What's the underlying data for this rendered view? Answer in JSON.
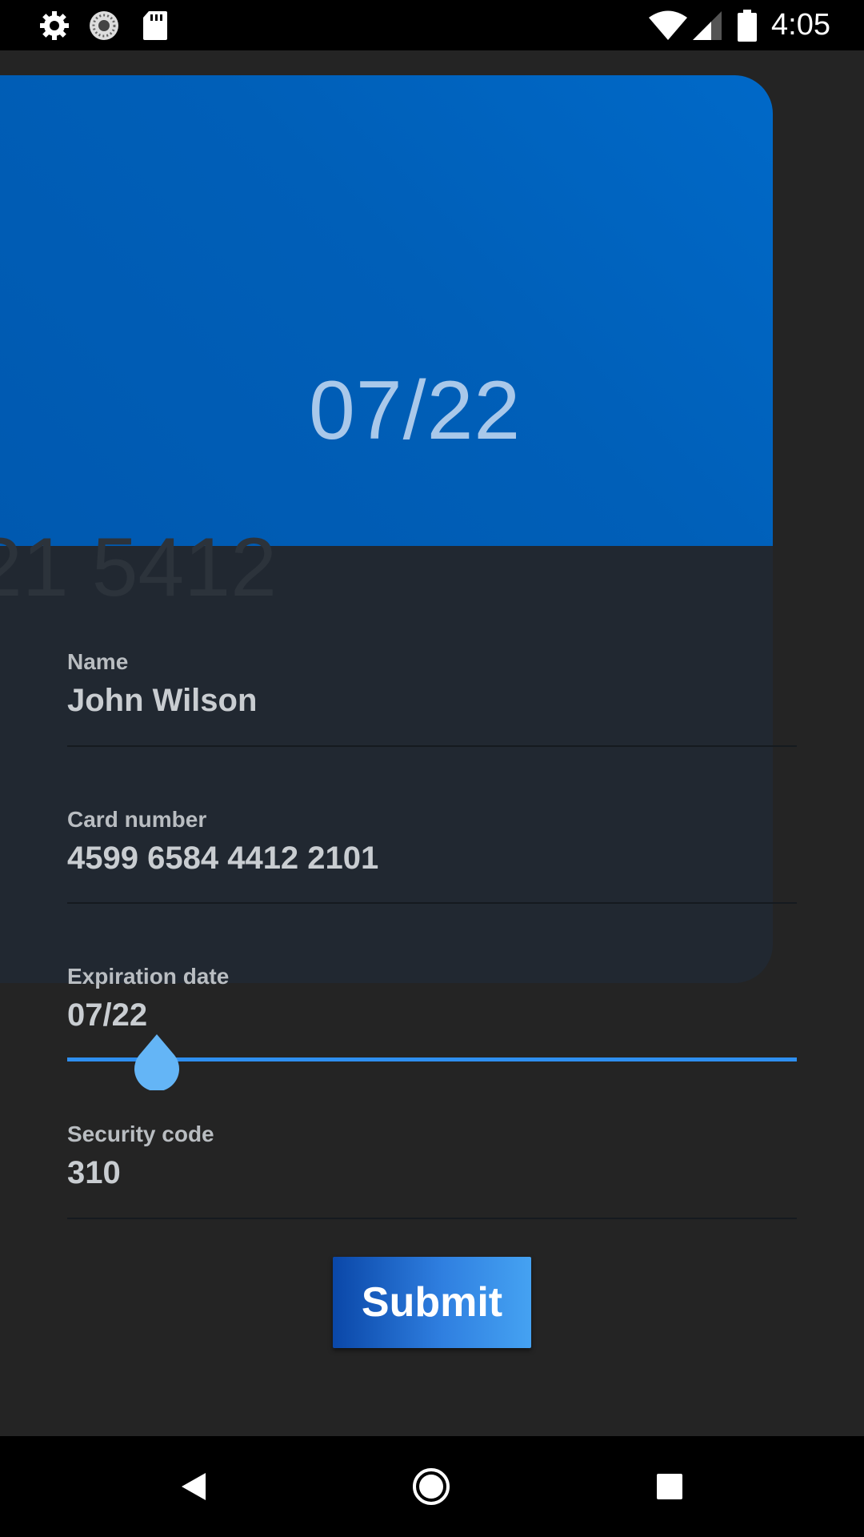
{
  "status_bar": {
    "time": "4:05",
    "icons": [
      "gear-icon",
      "sync-icon",
      "sd-card-icon",
      "wifi-icon",
      "signal-icon",
      "battery-icon"
    ]
  },
  "card": {
    "expiry": "07/22",
    "number_partial": "21 5412",
    "colors": {
      "top": "#0062BE",
      "bottom": "#212831"
    }
  },
  "form": {
    "name": {
      "label": "Name",
      "value": "John Wilson"
    },
    "card_number": {
      "label": "Card number",
      "value": "4599 6584 4412 2101"
    },
    "expiration": {
      "label": "Expiration date",
      "value": "07/22"
    },
    "security_code": {
      "label": "Security code",
      "value": "310"
    },
    "accent_color": "#2E8FF0"
  },
  "submit": {
    "label": "Submit"
  },
  "nav_bar": {
    "icons": [
      "back-icon",
      "home-icon",
      "recents-icon"
    ]
  }
}
